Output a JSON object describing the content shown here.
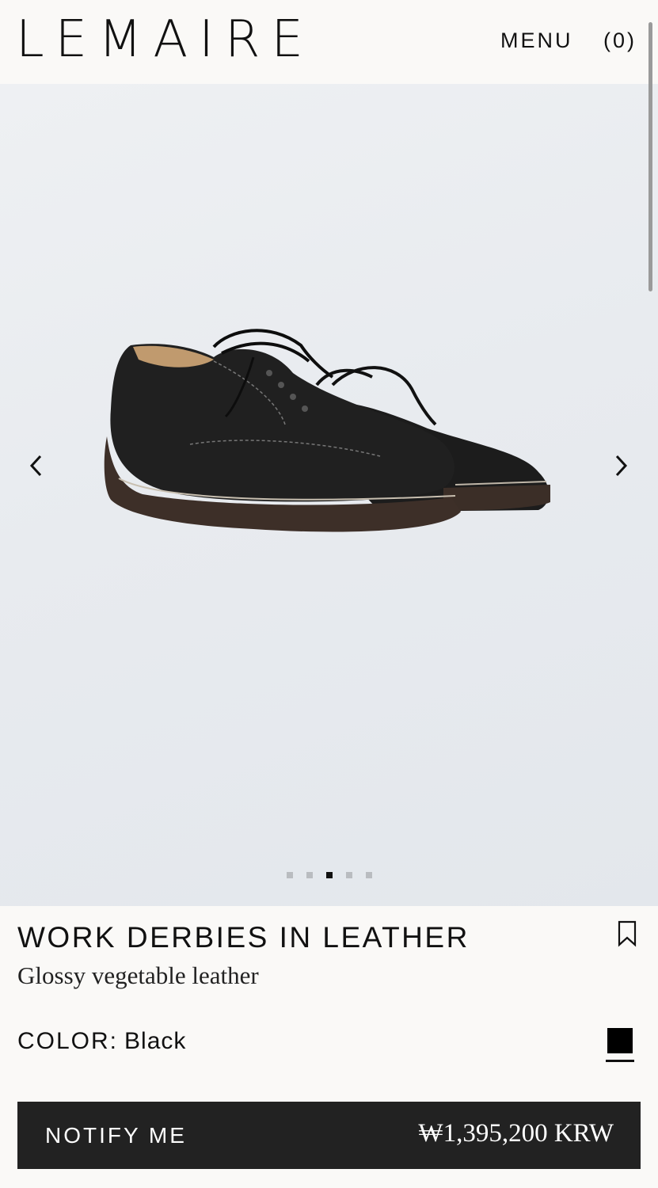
{
  "header": {
    "logo": "LEMAIRE",
    "menu_label": "MENU",
    "cart_label": "(0)"
  },
  "gallery": {
    "image_alt": "Work derbies in leather, black",
    "slide_count": 5,
    "active_slide": 3
  },
  "product": {
    "title": "WORK DERBIES IN LEATHER",
    "subtitle": "Glossy vegetable leather",
    "color_label": "COLOR:",
    "color_value": "Black",
    "swatch_color": "#000000"
  },
  "cta": {
    "label": "NOTIFY ME",
    "price": "₩1,395,200 KRW",
    "background": "#222222"
  },
  "icons": [
    "chevron-left-icon",
    "chevron-right-icon",
    "bookmark-icon"
  ]
}
